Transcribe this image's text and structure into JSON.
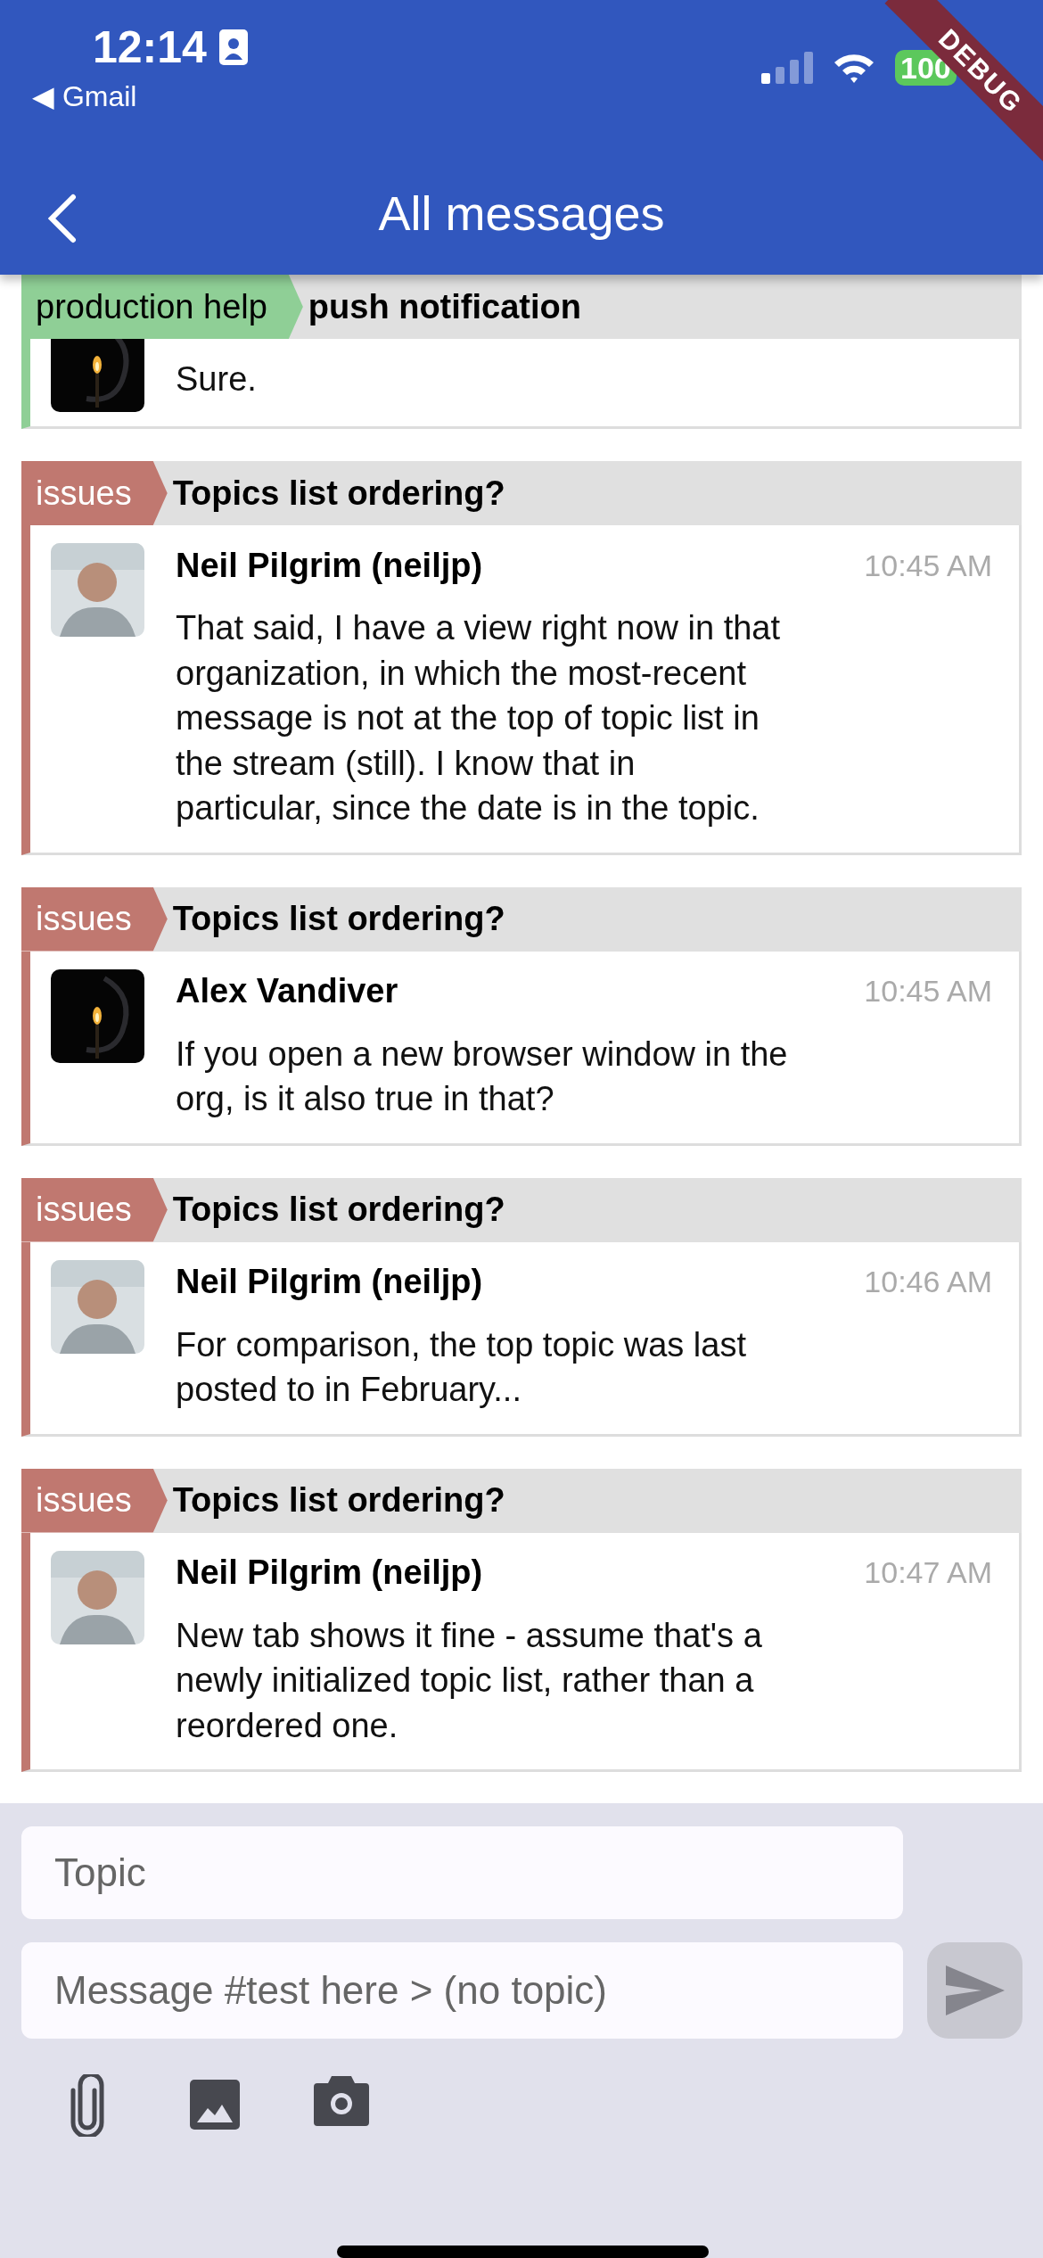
{
  "status_bar": {
    "time": "12:14",
    "back_app": "◀ Gmail",
    "battery": "100"
  },
  "debug_banner": "DEBUG",
  "app_bar": {
    "title": "All messages"
  },
  "messages": [
    {
      "stream": "production help",
      "color": "#8fcf96",
      "topic": "push notification",
      "avatar": {
        "kind": "dark"
      },
      "content": "Sure."
    },
    {
      "stream": "issues",
      "color": "#c07870",
      "topic": "Topics list ordering?",
      "avatar": {
        "kind": "light"
      },
      "sender": "Neil Pilgrim (neiljp)",
      "time": "10:45 AM",
      "content": "That said, I have a view right now in that organization, in which the most-recent message is not at the top of topic list in the stream (still). I know that in particular, since the date is in the topic."
    },
    {
      "stream": "issues",
      "color": "#c07870",
      "topic": "Topics list ordering?",
      "avatar": {
        "kind": "dark"
      },
      "sender": "Alex Vandiver",
      "time": "10:45 AM",
      "content": "If you open a new browser window in the org, is it also true in that?"
    },
    {
      "stream": "issues",
      "color": "#c07870",
      "topic": "Topics list ordering?",
      "avatar": {
        "kind": "light"
      },
      "sender": "Neil Pilgrim (neiljp)",
      "time": "10:46 AM",
      "content": "For comparison, the top topic was last posted to in February..."
    },
    {
      "stream": "issues",
      "color": "#c07870",
      "topic": "Topics list ordering?",
      "avatar": {
        "kind": "light"
      },
      "sender": "Neil Pilgrim (neiljp)",
      "time": "10:47 AM",
      "content": "New tab shows it fine - assume that's a newly initialized topic list, rather than a reordered one."
    }
  ],
  "compose": {
    "topic_field": {
      "placeholder": "Topic"
    },
    "message_field": {
      "placeholder": "Message #test here > (no topic)"
    }
  }
}
